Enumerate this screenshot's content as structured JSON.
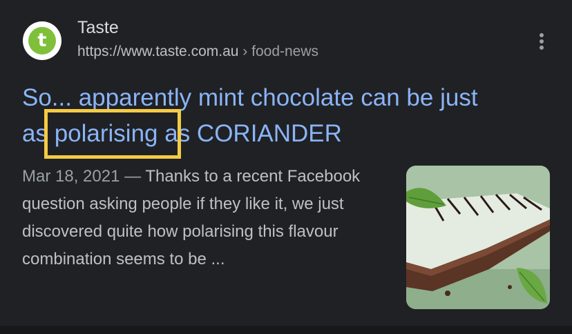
{
  "result": {
    "site_name": "Taste",
    "favicon_letter": "t",
    "url_base": "https://www.taste.com.au",
    "url_separator": "›",
    "url_path": "food-news",
    "title_line1": "So... apparently mint chocolate can be just",
    "title_line2": "as polarising as CORIANDER",
    "date": "Mar 18, 2021",
    "date_separator": "—",
    "snippet": "Thanks to a recent Facebook question asking people if they like it, we just discovered quite how polarising this flavour combination seems to be ...",
    "thumbnail_alt": "mint chocolate slice"
  },
  "annotation": {
    "highlighted_word": "polarising",
    "highlight_color": "#f4cb45"
  },
  "colors": {
    "background": "#202124",
    "title_link": "#8ab4f8",
    "body_text": "#bdc1c6",
    "favicon_green": "#7fc03b"
  },
  "icons": {
    "more": "more-vert-icon"
  }
}
